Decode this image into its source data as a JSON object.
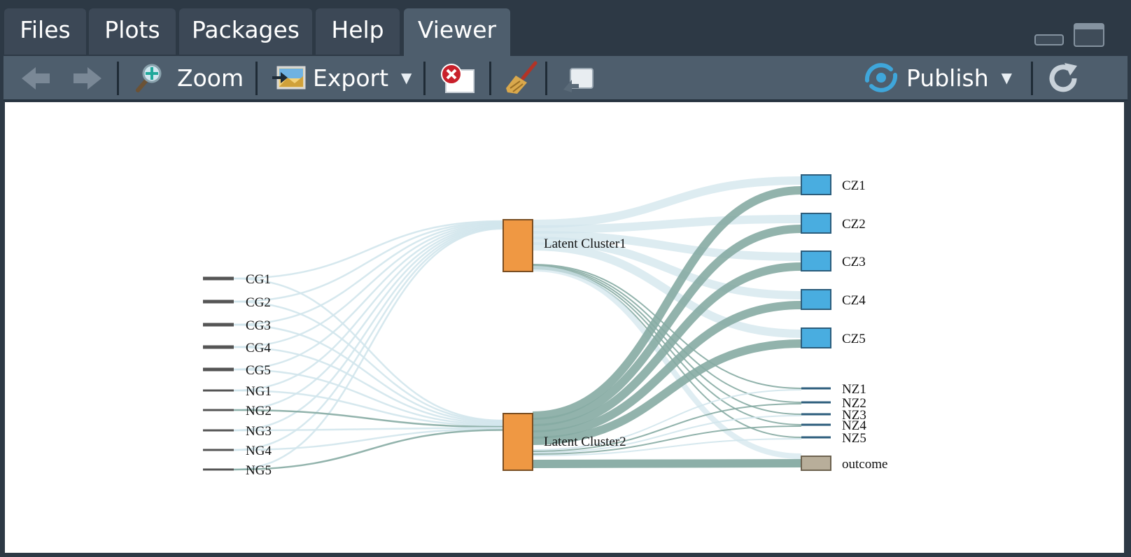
{
  "tabs": [
    {
      "label": "Files",
      "active": false
    },
    {
      "label": "Plots",
      "active": false
    },
    {
      "label": "Packages",
      "active": false
    },
    {
      "label": "Help",
      "active": false
    },
    {
      "label": "Viewer",
      "active": true
    }
  ],
  "toolbar": {
    "zoom_label": "Zoom",
    "export_label": "Export",
    "publish_label": "Publish"
  },
  "colors": {
    "accent_blue": "#49ade0",
    "cluster_orange": "#ef9843",
    "outcome_tan": "#b8ae9a",
    "link_light": "#d2e6ec",
    "link_dark": "#86aba3"
  },
  "sankey": {
    "left_nodes": [
      "CG1",
      "CG2",
      "CG3",
      "CG4",
      "CG5",
      "NG1",
      "NG2",
      "NG3",
      "NG4",
      "NG5"
    ],
    "middle_nodes": [
      "Latent Cluster1",
      "Latent Cluster2"
    ],
    "right_nodes": [
      "CZ1",
      "CZ2",
      "CZ3",
      "CZ4",
      "CZ5",
      "NZ1",
      "NZ2",
      "NZ3",
      "NZ4",
      "NZ5",
      "outcome"
    ]
  }
}
